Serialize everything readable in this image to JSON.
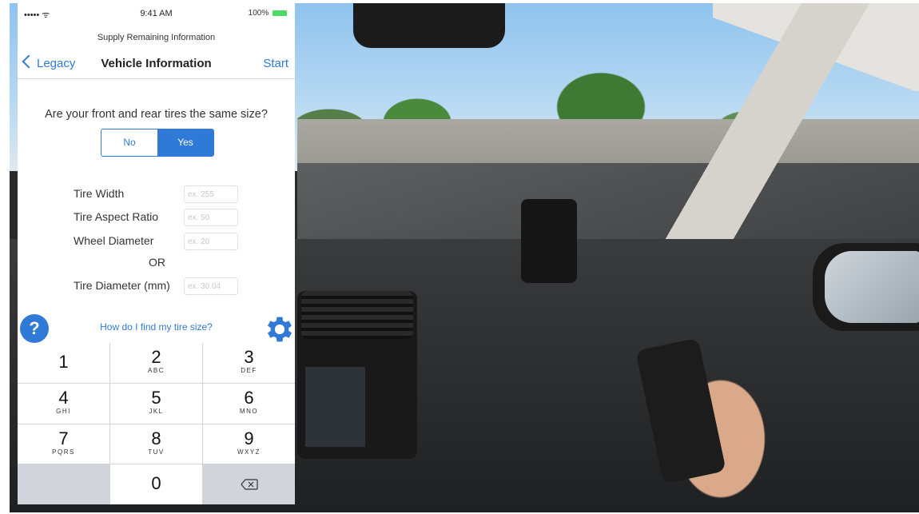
{
  "status": {
    "signal": "••••• ᯤ",
    "time": "9:41 AM",
    "right": "100%"
  },
  "nav": {
    "subtitle": "Supply Remaining Information",
    "back_label": "Legacy",
    "title": "Vehicle Information",
    "start_label": "Start"
  },
  "form": {
    "question": "Are your front and rear tires the same size?",
    "no_label": "No",
    "yes_label": "Yes",
    "selected": "Yes",
    "fields": [
      {
        "label": "Tire Width",
        "placeholder": "ex. 255"
      },
      {
        "label": "Tire Aspect Ratio",
        "placeholder": "ex. 50"
      },
      {
        "label": "Wheel Diameter",
        "placeholder": "ex. 20"
      },
      {
        "label": "Tire Diameter (mm)",
        "placeholder": "ex. 30.04"
      }
    ],
    "or_label": "OR",
    "help_link": "How do I find my tire size?",
    "help_icon": "?"
  },
  "keypad": [
    {
      "num": "1",
      "letters": ""
    },
    {
      "num": "2",
      "letters": "ABC"
    },
    {
      "num": "3",
      "letters": "DEF"
    },
    {
      "num": "4",
      "letters": "GHI"
    },
    {
      "num": "5",
      "letters": "JKL"
    },
    {
      "num": "6",
      "letters": "MNO"
    },
    {
      "num": "7",
      "letters": "PQRS"
    },
    {
      "num": "8",
      "letters": "TUV"
    },
    {
      "num": "9",
      "letters": "WXYZ"
    },
    {
      "num": "0",
      "letters": ""
    }
  ],
  "colors": {
    "accent": "#2f7ad6",
    "battery": "#4cd964"
  }
}
